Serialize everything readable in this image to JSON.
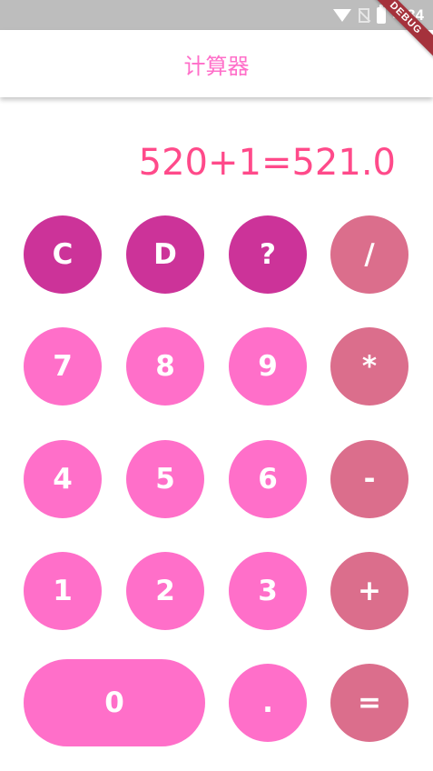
{
  "status_bar": {
    "time": "4:34",
    "debug_banner": "DEBUG"
  },
  "app_bar": {
    "title": "计算器"
  },
  "display": {
    "expression": "520+1=521.0"
  },
  "keys": {
    "clear": "C",
    "delete": "D",
    "question": "?",
    "divide": "/",
    "seven": "7",
    "eight": "8",
    "nine": "9",
    "multiply": "*",
    "four": "4",
    "five": "5",
    "six": "6",
    "subtract": "-",
    "one": "1",
    "two": "2",
    "three": "3",
    "add": "+",
    "zero": "0",
    "decimal": ".",
    "equals": "="
  },
  "colors": {
    "function_key": "#cc3399",
    "number_key": "#ff6fc9",
    "operator_key": "#db6e8c",
    "title": "#ff6fc9",
    "display_text": "#ff4a8a",
    "status_bar": "#bdbdbd"
  }
}
